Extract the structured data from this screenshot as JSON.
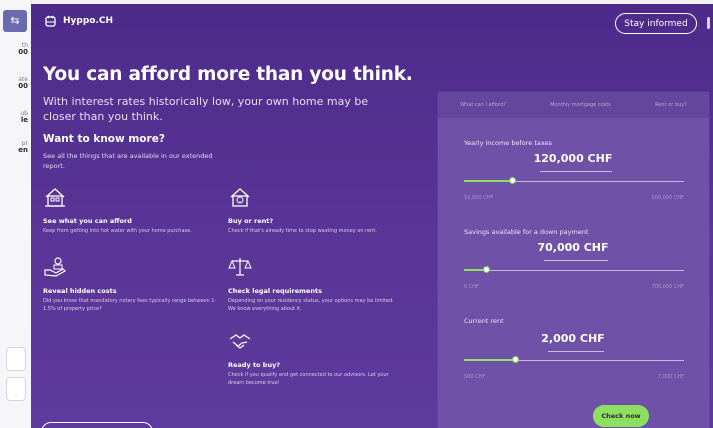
{
  "left_strip": {
    "tab_glyph": "⇆",
    "labels": [
      {
        "caption": "th",
        "value": "00"
      },
      {
        "caption": "ate",
        "value": "00"
      },
      {
        "caption": "ub",
        "value": "le"
      },
      {
        "caption": "pr",
        "value": "en"
      }
    ]
  },
  "header": {
    "brand": "Hyppo.CH",
    "stay_informed": "Stay informed"
  },
  "hero": {
    "title": "You can afford more than you think.",
    "subtitle": "With interest rates historically low, your own home may be closer than you think."
  },
  "know_more": {
    "title": "Want to know more?",
    "subtitle": "See all the things that are available in our extended report."
  },
  "features": [
    {
      "icon": "house-search-icon",
      "title": "See what you can afford",
      "desc": "Keep from getting into hot water with your home purchase."
    },
    {
      "icon": "house-question-icon",
      "title": "Buy or rent?",
      "desc": "Check if that's already time to stop wasting money on rent."
    },
    {
      "icon": "hand-money-icon",
      "title": "Reveal hidden costs",
      "desc": "Did you know that mandatory notary fees typically range between 1-1.5% of property price?"
    },
    {
      "icon": "scales-icon",
      "title": "Check legal requirements",
      "desc": "Depending on your residency status, your options may be limited. We know everything about it."
    },
    {
      "icon": "handshake-icon",
      "title": "Ready to buy?",
      "desc": "Check if you qualify and get connected to our advisors. Let your dream become true!"
    }
  ],
  "calculator": {
    "tabs": [
      "What can I afford?",
      "Monthly mortgage costs",
      "Rent or buy?"
    ],
    "fields": [
      {
        "label": "Yearly income before taxes",
        "value": "120,000 CHF",
        "min": "10,000 CHF",
        "max": "500,000 CHF",
        "fraction": 0.22
      },
      {
        "label": "Savings available for a down payment",
        "value": "70,000 CHF",
        "min": "0 CHF",
        "max": "700,000 CHF",
        "fraction": 0.1
      },
      {
        "label": "Current rent",
        "value": "2,000 CHF",
        "min": "500 CHF",
        "max": "7,000 CHF",
        "fraction": 0.23
      }
    ],
    "check_now": "Check now"
  },
  "colors": {
    "accent_green": "#8de05f",
    "brand_purple": "#5a3597"
  }
}
